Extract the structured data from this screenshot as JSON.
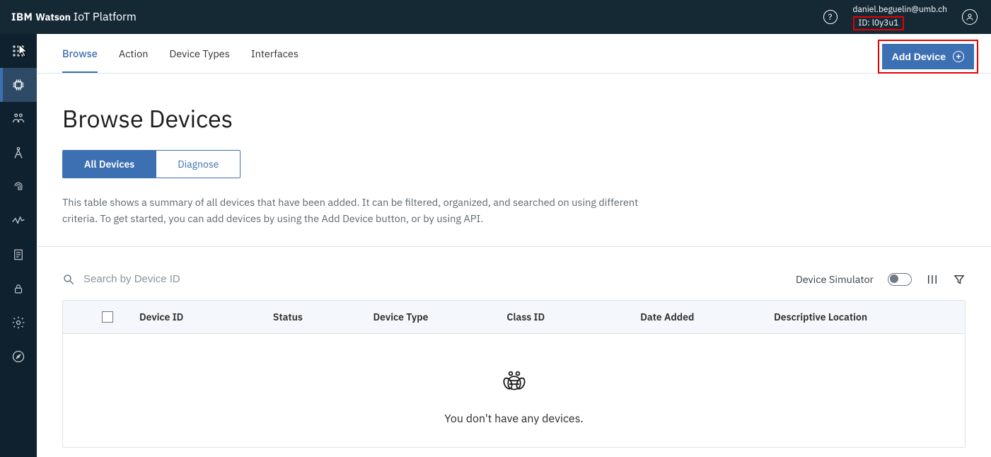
{
  "header": {
    "brand_ibm": "IBM",
    "brand_bold": "Watson",
    "brand_rest": " IoT Platform",
    "user_email": "daniel.beguelin@umb.ch",
    "org_id_label": "ID: l0y3u1"
  },
  "sidebar": {
    "items": [
      {
        "name": "apps"
      },
      {
        "name": "devices"
      },
      {
        "name": "members"
      },
      {
        "name": "drafting"
      },
      {
        "name": "fingerprint"
      },
      {
        "name": "usage"
      },
      {
        "name": "logs"
      },
      {
        "name": "security"
      },
      {
        "name": "settings"
      },
      {
        "name": "extensions"
      }
    ]
  },
  "tabs": {
    "items": [
      {
        "label": "Browse",
        "active": true
      },
      {
        "label": "Action"
      },
      {
        "label": "Device Types"
      },
      {
        "label": "Interfaces"
      }
    ]
  },
  "buttons": {
    "add_device": "Add Device"
  },
  "page": {
    "title": "Browse Devices",
    "segment": {
      "all": "All Devices",
      "diag": "Diagnose"
    },
    "description": "This table shows a summary of all devices that have been added. It can be filtered, organized, and searched on using different criteria. To get started, you can add devices by using the Add Device button, or by using API."
  },
  "toolbar": {
    "search_placeholder": "Search by Device ID",
    "simulator_label": "Device Simulator"
  },
  "table": {
    "columns": [
      "Device ID",
      "Status",
      "Device Type",
      "Class ID",
      "Date Added",
      "Descriptive Location"
    ],
    "empty_message": "You don't have any devices."
  }
}
